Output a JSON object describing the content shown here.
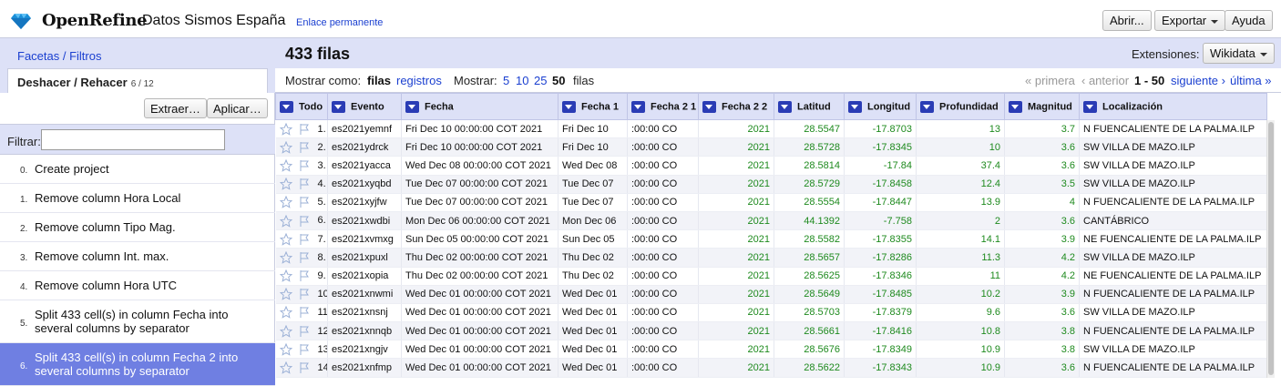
{
  "header": {
    "app_name": "OpenRefine",
    "project_name": "Datos Sismos España",
    "permalink": "Enlace permanente",
    "buttons": {
      "open": "Abrir...",
      "export": "Exportar",
      "help": "Ayuda"
    },
    "logo_icon": "diamond-logo-icon"
  },
  "left": {
    "tab_facets": "Facetas / Filtros",
    "tab_undo": "Deshacer / Rehacer",
    "undo_count": "6 / 12",
    "extract_label": "Extraer…",
    "apply_label": "Aplicar…",
    "filter_label": "Filtrar:",
    "history": [
      {
        "idx": "0.",
        "label": "Create project"
      },
      {
        "idx": "1.",
        "label": "Remove column Hora Local"
      },
      {
        "idx": "2.",
        "label": "Remove column Tipo Mag."
      },
      {
        "idx": "3.",
        "label": "Remove column Int. max."
      },
      {
        "idx": "4.",
        "label": "Remove column Hora UTC"
      },
      {
        "idx": "5.",
        "label": "Split 433 cell(s) in column Fecha into several columns by separator"
      },
      {
        "idx": "6.",
        "label": "Split 433 cell(s) in column Fecha 2 into several columns by separator"
      }
    ]
  },
  "right": {
    "row_count": "433 filas",
    "extensions_label": "Extensiones:",
    "wikidata_label": "Wikidata",
    "view": {
      "show_as": "Mostrar como:",
      "rows_mode": "filas",
      "records_mode": "registros",
      "show": "Mostrar:",
      "sizes": [
        "5",
        "10",
        "25"
      ],
      "size_current": "50",
      "rows_word": "filas",
      "first": "« primera",
      "prev": "‹ anterior",
      "range": "1 - 50",
      "next": "siguiente ›",
      "last": "última »"
    },
    "columns": [
      "Todo",
      "Evento",
      "Fecha",
      "Fecha 1",
      "Fecha 2 1",
      "Fecha 2 2",
      "Latitud",
      "Longitud",
      "Profundidad",
      "Magnitud",
      "Localización"
    ],
    "rows": [
      [
        "1.",
        "es2021yemnf",
        "Fri Dec 10 00:00:00 COT 2021",
        "Fri Dec 10",
        ":00:00 CO",
        "2021",
        "28.5547",
        "-17.8703",
        "13",
        "3.7",
        "N FUENCALIENTE DE LA PALMA.ILP"
      ],
      [
        "2.",
        "es2021ydrck",
        "Fri Dec 10 00:00:00 COT 2021",
        "Fri Dec 10",
        ":00:00 CO",
        "2021",
        "28.5728",
        "-17.8345",
        "10",
        "3.6",
        "SW VILLA DE MAZO.ILP"
      ],
      [
        "3.",
        "es2021yacca",
        "Wed Dec 08 00:00:00 COT 2021",
        "Wed Dec 08",
        ":00:00 CO",
        "2021",
        "28.5814",
        "-17.84",
        "37.4",
        "3.6",
        "SW VILLA DE MAZO.ILP"
      ],
      [
        "4.",
        "es2021xyqbd",
        "Tue Dec 07 00:00:00 COT 2021",
        "Tue Dec 07",
        ":00:00 CO",
        "2021",
        "28.5729",
        "-17.8458",
        "12.4",
        "3.5",
        "SW VILLA DE MAZO.ILP"
      ],
      [
        "5.",
        "es2021xyjfw",
        "Tue Dec 07 00:00:00 COT 2021",
        "Tue Dec 07",
        ":00:00 CO",
        "2021",
        "28.5554",
        "-17.8447",
        "13.9",
        "4",
        "N FUENCALIENTE DE LA PALMA.ILP"
      ],
      [
        "6.",
        "es2021xwdbi",
        "Mon Dec 06 00:00:00 COT 2021",
        "Mon Dec 06",
        ":00:00 CO",
        "2021",
        "44.1392",
        "-7.758",
        "2",
        "3.6",
        "CANTÁBRICO"
      ],
      [
        "7.",
        "es2021xvmxg",
        "Sun Dec 05 00:00:00 COT 2021",
        "Sun Dec 05",
        ":00:00 CO",
        "2021",
        "28.5582",
        "-17.8355",
        "14.1",
        "3.9",
        "NE FUENCALIENTE DE LA PALMA.ILP"
      ],
      [
        "8.",
        "es2021xpuxl",
        "Thu Dec 02 00:00:00 COT 2021",
        "Thu Dec 02",
        ":00:00 CO",
        "2021",
        "28.5657",
        "-17.8286",
        "11.3",
        "4.2",
        "SW VILLA DE MAZO.ILP"
      ],
      [
        "9.",
        "es2021xopia",
        "Thu Dec 02 00:00:00 COT 2021",
        "Thu Dec 02",
        ":00:00 CO",
        "2021",
        "28.5625",
        "-17.8346",
        "11",
        "4.2",
        "NE FUENCALIENTE DE LA PALMA.ILP"
      ],
      [
        "10.",
        "es2021xnwmi",
        "Wed Dec 01 00:00:00 COT 2021",
        "Wed Dec 01",
        ":00:00 CO",
        "2021",
        "28.5649",
        "-17.8485",
        "10.2",
        "3.9",
        "N FUENCALIENTE DE LA PALMA.ILP"
      ],
      [
        "11.",
        "es2021xnsnj",
        "Wed Dec 01 00:00:00 COT 2021",
        "Wed Dec 01",
        ":00:00 CO",
        "2021",
        "28.5703",
        "-17.8379",
        "9.6",
        "3.6",
        "SW VILLA DE MAZO.ILP"
      ],
      [
        "12.",
        "es2021xnnqb",
        "Wed Dec 01 00:00:00 COT 2021",
        "Wed Dec 01",
        ":00:00 CO",
        "2021",
        "28.5661",
        "-17.8416",
        "10.8",
        "3.8",
        "N FUENCALIENTE DE LA PALMA.ILP"
      ],
      [
        "13.",
        "es2021xngjv",
        "Wed Dec 01 00:00:00 COT 2021",
        "Wed Dec 01",
        ":00:00 CO",
        "2021",
        "28.5676",
        "-17.8349",
        "10.9",
        "3.8",
        "SW VILLA DE MAZO.ILP"
      ],
      [
        "14.",
        "es2021xnfmp",
        "Wed Dec 01 00:00:00 COT 2021",
        "Wed Dec 01",
        ":00:00 CO",
        "2021",
        "28.5622",
        "-17.8343",
        "10.9",
        "3.6",
        "N FUENCALIENTE DE LA PALMA.ILP"
      ]
    ]
  },
  "colors": {
    "accent": "#2a3cb5",
    "panel_bg": "#dde1f7",
    "selected": "#6f7fe2",
    "number_green": "#1e8a1e",
    "link": "#1a3fd0"
  }
}
